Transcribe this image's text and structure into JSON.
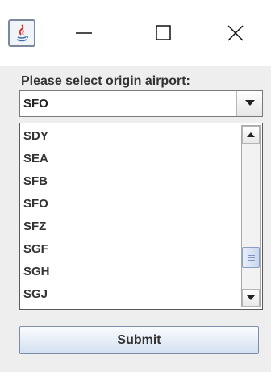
{
  "dialog": {
    "prompt": "Please select origin airport:",
    "combo_value": "SFO",
    "options": [
      "SDY",
      "SEA",
      "SFB",
      "SFO",
      "SFZ",
      "SGF",
      "SGH",
      "SGJ"
    ],
    "submit_label": "Submit"
  },
  "titlebar": {
    "icons": [
      "java-app-icon",
      "minimize-icon",
      "maximize-icon",
      "close-icon"
    ]
  },
  "colors": {
    "background": "#eeeeee",
    "button_gradient_top": "#fbfdff",
    "button_gradient_bottom": "#d3e0f0",
    "scroll_thumb": "#c9d7ee"
  }
}
